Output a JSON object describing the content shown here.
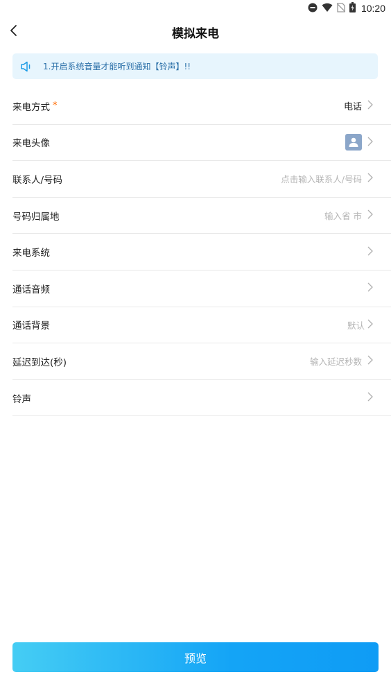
{
  "status_bar": {
    "time": "10:20",
    "icons": [
      "do-not-disturb-icon",
      "wifi-icon",
      "no-sim-icon",
      "battery-icon"
    ]
  },
  "nav": {
    "title": "模拟来电",
    "back_icon": "chevron-left-icon"
  },
  "notice": {
    "icon": "speaker-icon",
    "text": "1.开启系统音量才能听到通知【铃声】!!"
  },
  "form": {
    "rows": [
      {
        "label": "来电方式",
        "required_mark": "*",
        "value": "电话"
      },
      {
        "label": "来电头像",
        "avatar_icon": "person-avatar-icon"
      },
      {
        "label": "联系人/号码",
        "placeholder": "点击输入联系人/号码"
      },
      {
        "label": "号码归属地",
        "placeholder": "输入省 市"
      },
      {
        "label": "来电系统"
      },
      {
        "label": "通话音频"
      },
      {
        "label": "通话背景",
        "placeholder": "默认"
      },
      {
        "label": "延迟到达(秒)",
        "placeholder": "输入延迟秒数"
      },
      {
        "label": "铃声"
      }
    ]
  },
  "preview_button": {
    "label": "预览"
  },
  "colors": {
    "notice_bg": "#e7f5fd",
    "notice_text": "#2a6fa8",
    "required": "#ff6a00",
    "button_gradient_start": "#45cdf4",
    "button_gradient_end": "#0f9cf5"
  }
}
